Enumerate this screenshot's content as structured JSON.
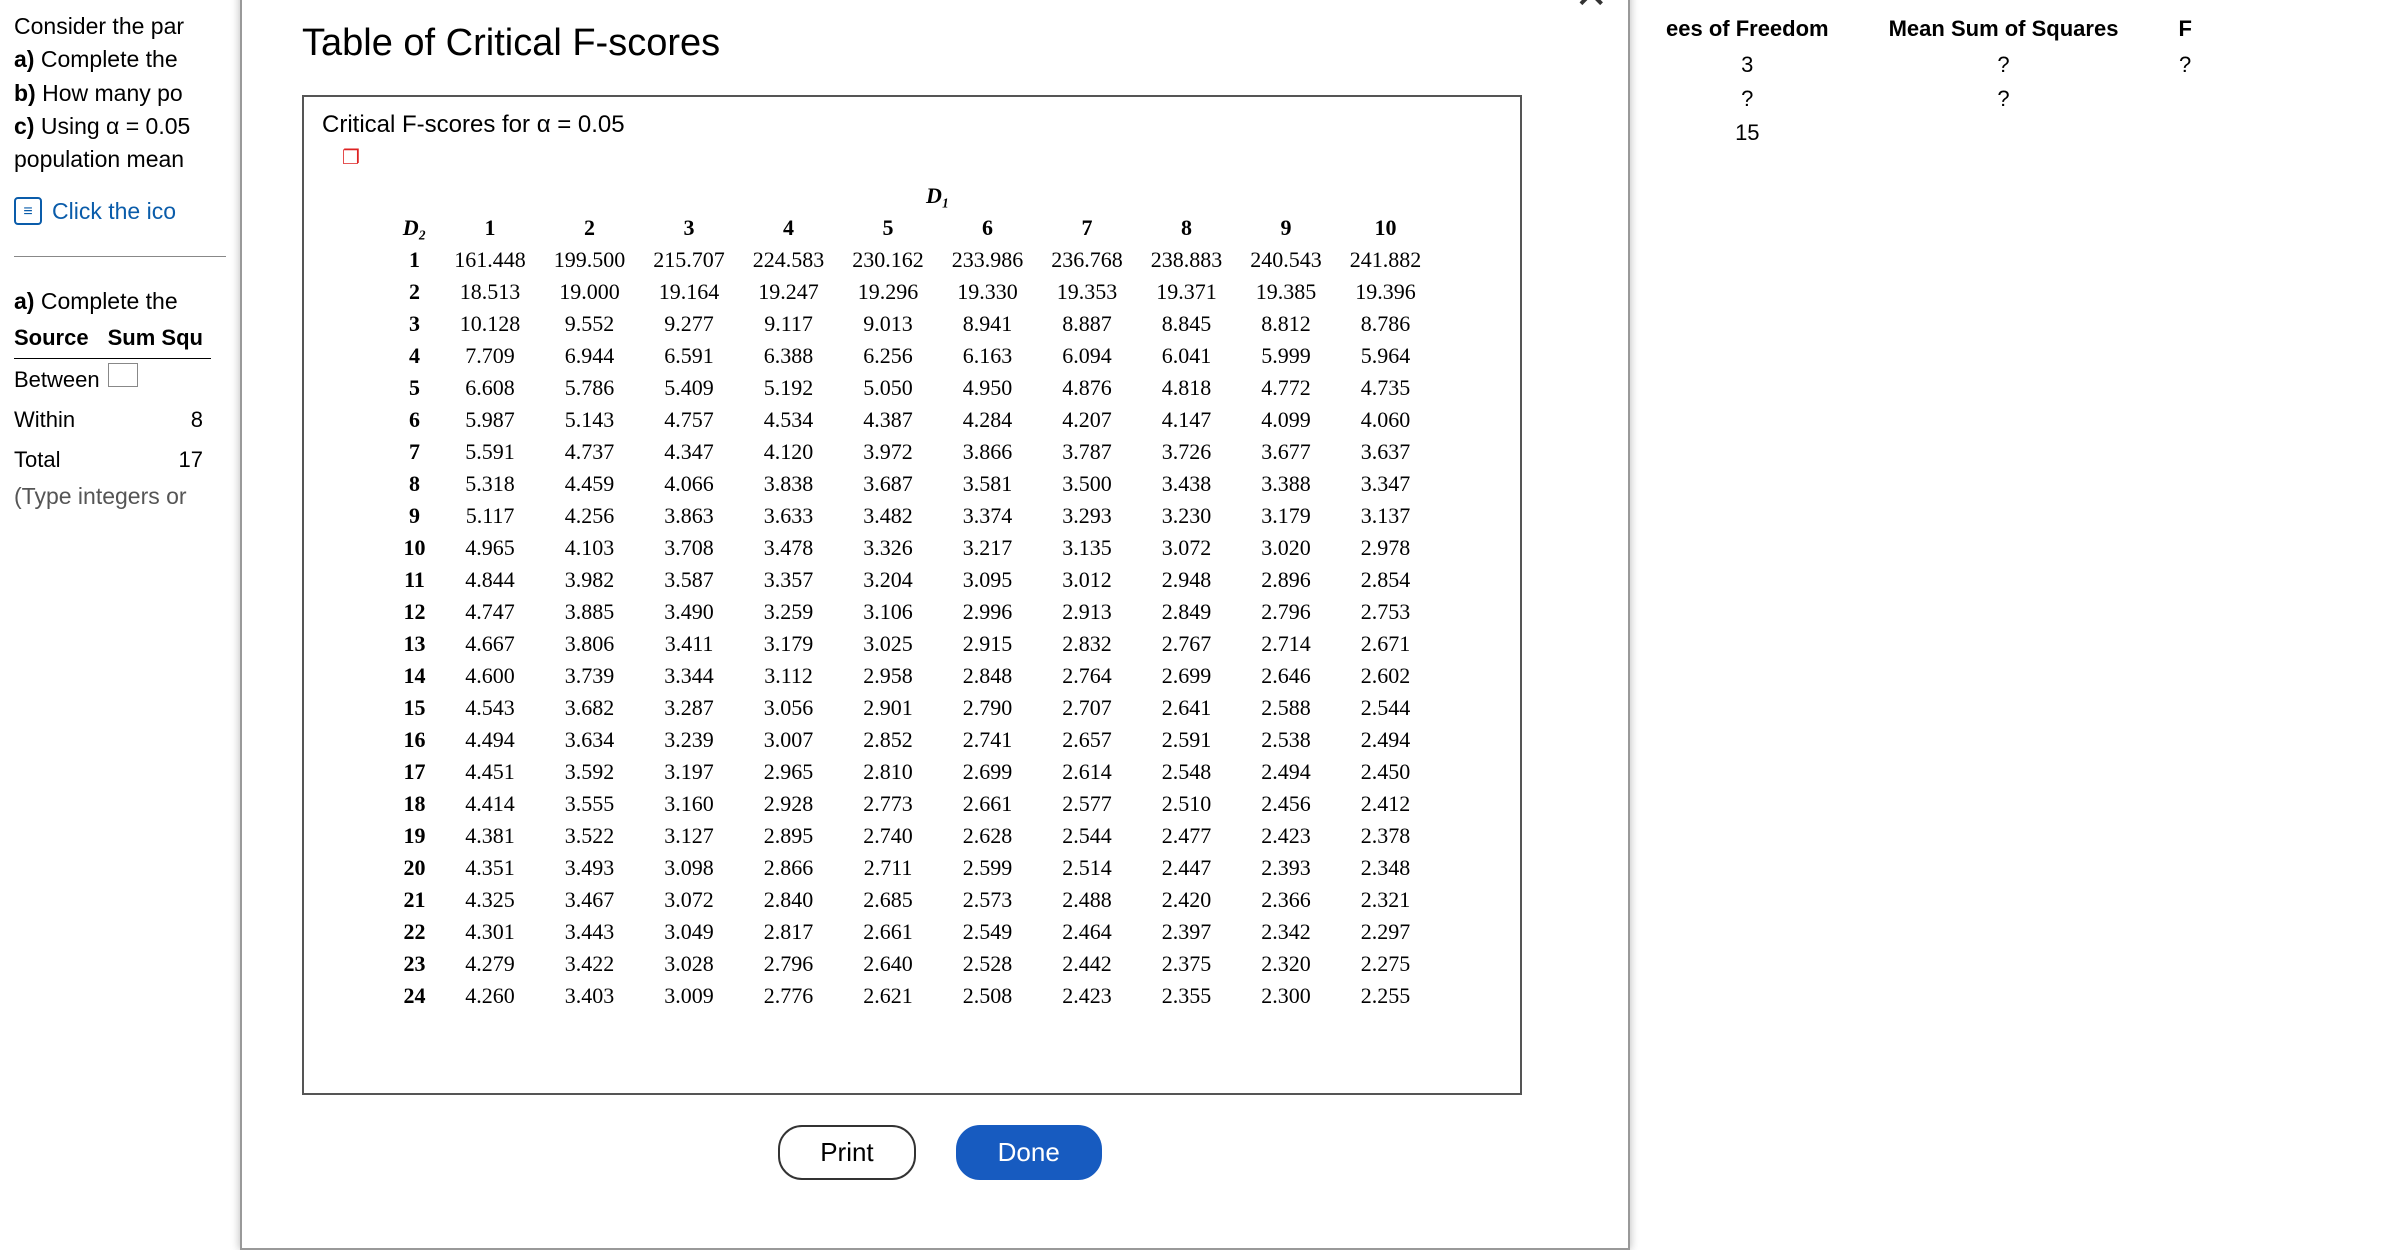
{
  "question": {
    "intro": "Consider the par",
    "parts": [
      {
        "prefix": "a) ",
        "text": "Complete the"
      },
      {
        "prefix": "b) ",
        "text": "How many po"
      },
      {
        "prefix": "c) ",
        "text": "Using α = 0.05"
      }
    ],
    "tail": "population mean",
    "click_link": "Click the ico",
    "part_a_repeat": "a) Complete the ",
    "anova_headers": [
      "Source",
      "Sum Squ"
    ],
    "anova_rows": [
      {
        "label": "Between",
        "val": ""
      },
      {
        "label": "Within",
        "val": "8"
      },
      {
        "label": "Total",
        "val": "17"
      }
    ],
    "type_note": "(Type integers or"
  },
  "modal": {
    "title": "Table of Critical F-scores",
    "caption": "Critical F-scores for α = 0.05",
    "popout_glyph": "❐",
    "d1_label": "D₁",
    "d2_label": "D₂",
    "print_btn": "Print",
    "done_btn": "Done"
  },
  "chart_data": {
    "type": "table",
    "title": "Critical F-scores for α = 0.05",
    "columns_label": "D1 (numerator df)",
    "rows_label": "D2 (denominator df)",
    "columns": [
      1,
      2,
      3,
      4,
      5,
      6,
      7,
      8,
      9,
      10
    ],
    "rows": [
      1,
      2,
      3,
      4,
      5,
      6,
      7,
      8,
      9,
      10,
      11,
      12,
      13,
      14,
      15,
      16,
      17,
      18,
      19,
      20,
      21,
      22,
      23,
      24
    ],
    "values": [
      [
        161.448,
        199.5,
        215.707,
        224.583,
        230.162,
        233.986,
        236.768,
        238.883,
        240.543,
        241.882
      ],
      [
        18.513,
        19.0,
        19.164,
        19.247,
        19.296,
        19.33,
        19.353,
        19.371,
        19.385,
        19.396
      ],
      [
        10.128,
        9.552,
        9.277,
        9.117,
        9.013,
        8.941,
        8.887,
        8.845,
        8.812,
        8.786
      ],
      [
        7.709,
        6.944,
        6.591,
        6.388,
        6.256,
        6.163,
        6.094,
        6.041,
        5.999,
        5.964
      ],
      [
        6.608,
        5.786,
        5.409,
        5.192,
        5.05,
        4.95,
        4.876,
        4.818,
        4.772,
        4.735
      ],
      [
        5.987,
        5.143,
        4.757,
        4.534,
        4.387,
        4.284,
        4.207,
        4.147,
        4.099,
        4.06
      ],
      [
        5.591,
        4.737,
        4.347,
        4.12,
        3.972,
        3.866,
        3.787,
        3.726,
        3.677,
        3.637
      ],
      [
        5.318,
        4.459,
        4.066,
        3.838,
        3.687,
        3.581,
        3.5,
        3.438,
        3.388,
        3.347
      ],
      [
        5.117,
        4.256,
        3.863,
        3.633,
        3.482,
        3.374,
        3.293,
        3.23,
        3.179,
        3.137
      ],
      [
        4.965,
        4.103,
        3.708,
        3.478,
        3.326,
        3.217,
        3.135,
        3.072,
        3.02,
        2.978
      ],
      [
        4.844,
        3.982,
        3.587,
        3.357,
        3.204,
        3.095,
        3.012,
        2.948,
        2.896,
        2.854
      ],
      [
        4.747,
        3.885,
        3.49,
        3.259,
        3.106,
        2.996,
        2.913,
        2.849,
        2.796,
        2.753
      ],
      [
        4.667,
        3.806,
        3.411,
        3.179,
        3.025,
        2.915,
        2.832,
        2.767,
        2.714,
        2.671
      ],
      [
        4.6,
        3.739,
        3.344,
        3.112,
        2.958,
        2.848,
        2.764,
        2.699,
        2.646,
        2.602
      ],
      [
        4.543,
        3.682,
        3.287,
        3.056,
        2.901,
        2.79,
        2.707,
        2.641,
        2.588,
        2.544
      ],
      [
        4.494,
        3.634,
        3.239,
        3.007,
        2.852,
        2.741,
        2.657,
        2.591,
        2.538,
        2.494
      ],
      [
        4.451,
        3.592,
        3.197,
        2.965,
        2.81,
        2.699,
        2.614,
        2.548,
        2.494,
        2.45
      ],
      [
        4.414,
        3.555,
        3.16,
        2.928,
        2.773,
        2.661,
        2.577,
        2.51,
        2.456,
        2.412
      ],
      [
        4.381,
        3.522,
        3.127,
        2.895,
        2.74,
        2.628,
        2.544,
        2.477,
        2.423,
        2.378
      ],
      [
        4.351,
        3.493,
        3.098,
        2.866,
        2.711,
        2.599,
        2.514,
        2.447,
        2.393,
        2.348
      ],
      [
        4.325,
        3.467,
        3.072,
        2.84,
        2.685,
        2.573,
        2.488,
        2.42,
        2.366,
        2.321
      ],
      [
        4.301,
        3.443,
        3.049,
        2.817,
        2.661,
        2.549,
        2.464,
        2.397,
        2.342,
        2.297
      ],
      [
        4.279,
        3.422,
        3.028,
        2.796,
        2.64,
        2.528,
        2.442,
        2.375,
        2.32,
        2.275
      ],
      [
        4.26,
        3.403,
        3.009,
        2.776,
        2.621,
        2.508,
        2.423,
        2.355,
        2.3,
        2.255
      ]
    ]
  },
  "right_panel": {
    "headers": [
      "ees of Freedom",
      "Mean Sum of Squares",
      "F"
    ],
    "rows": [
      [
        "3",
        "?",
        "?"
      ],
      [
        "?",
        "?",
        ""
      ],
      [
        "15",
        "",
        ""
      ]
    ]
  }
}
